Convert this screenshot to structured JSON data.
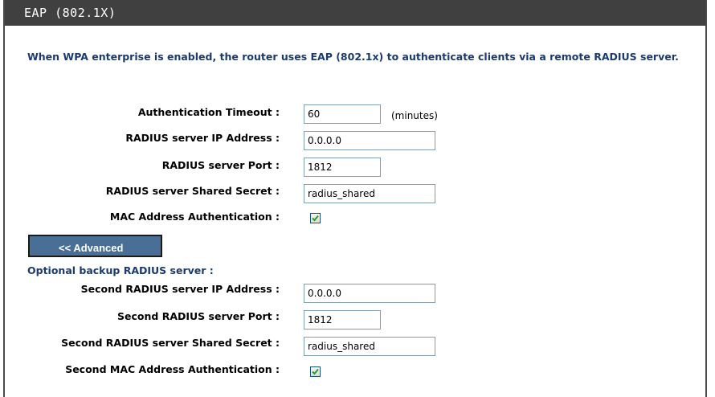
{
  "header": {
    "title": "EAP (802.1X)"
  },
  "intro": "When WPA enterprise is enabled, the router uses EAP (802.1x) to authenticate clients via a remote RADIUS server.",
  "primary": {
    "timeout_label": "Authentication Timeout :",
    "timeout_value": "60",
    "timeout_unit": "(minutes)",
    "ip_label": "RADIUS server IP Address :",
    "ip_value": "0.0.0.0",
    "port_label": "RADIUS server Port :",
    "port_value": "1812",
    "secret_label": "RADIUS server Shared Secret :",
    "secret_value": "radius_shared",
    "mac_label": "MAC Address Authentication :",
    "mac_checked": true
  },
  "advanced_button": "<< Advanced",
  "backup": {
    "section_title": "Optional backup RADIUS server :",
    "ip_label": "Second RADIUS server IP Address :",
    "ip_value": "0.0.0.0",
    "port_label": "Second RADIUS server Port :",
    "port_value": "1812",
    "secret_label": "Second RADIUS server Shared Secret :",
    "secret_value": "radius_shared",
    "mac_label": "Second MAC Address Authentication :",
    "mac_checked": true
  },
  "colors": {
    "header_bg": "#404040",
    "accent_text": "#1b3a6e",
    "button_bg": "#4a6f96",
    "check": "#21a121"
  }
}
